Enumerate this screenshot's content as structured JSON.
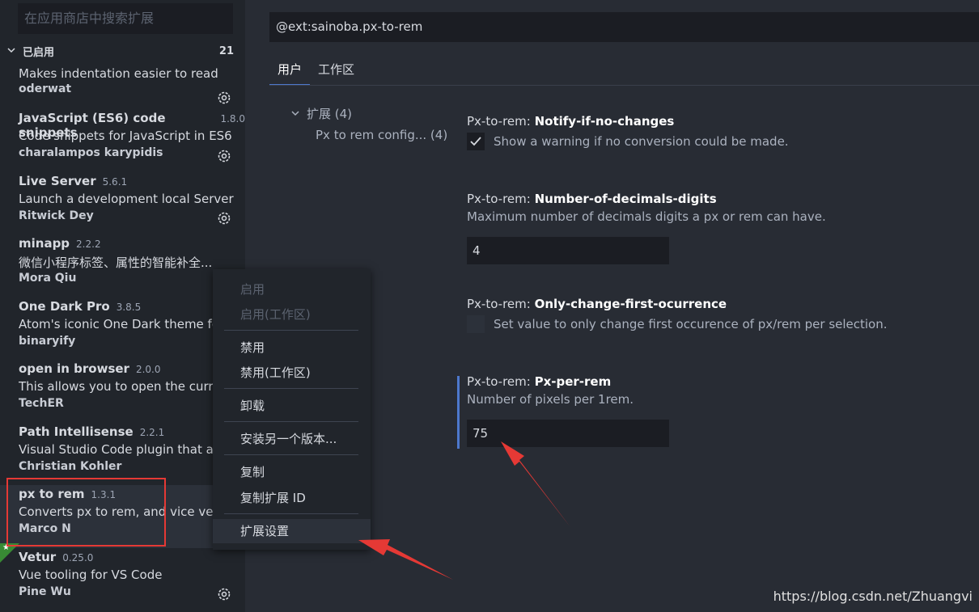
{
  "sidebar": {
    "search_placeholder": "在应用商店中搜索扩展",
    "section_title": "已启用",
    "section_count": "21",
    "extensions": [
      {
        "name": "",
        "version": "",
        "description": "Makes indentation easier to read",
        "author": "oderwat",
        "gear": true
      },
      {
        "name": "JavaScript (ES6) code snippets",
        "version": "1.8.0",
        "description": "Code snippets for JavaScript in ES6 ...",
        "author": "charalampos karypidis",
        "gear": true
      },
      {
        "name": "Live Server",
        "version": "5.6.1",
        "description": "Launch a development local Server ...",
        "author": "Ritwick Dey",
        "gear": true
      },
      {
        "name": "minapp",
        "version": "2.2.2",
        "description": "微信小程序标签、属性的智能补全...",
        "author": "Mora Qiu",
        "gear": false
      },
      {
        "name": "One Dark Pro",
        "version": "3.8.5",
        "description": "Atom's iconic One Dark theme for",
        "author": "binaryify",
        "gear": false
      },
      {
        "name": "open in browser",
        "version": "2.0.0",
        "description": "This allows you to open the curren",
        "author": "TechER",
        "gear": false
      },
      {
        "name": "Path Intellisense",
        "version": "2.2.1",
        "description": "Visual Studio Code plugin that au",
        "author": "Christian Kohler",
        "gear": false
      },
      {
        "name": "px to rem",
        "version": "1.3.1",
        "description": "Converts px to rem, and vice versa",
        "author": "Marco N",
        "gear": false
      },
      {
        "name": "Vetur",
        "version": "0.25.0",
        "description": "Vue tooling for VS Code",
        "author": "Pine Wu",
        "gear": true
      }
    ]
  },
  "context_menu": {
    "items": [
      {
        "label": "启用",
        "disabled": true
      },
      {
        "label": "启用(工作区)",
        "disabled": true
      },
      {
        "label": "禁用",
        "disabled": false
      },
      {
        "label": "禁用(工作区)",
        "disabled": false
      },
      {
        "label": "卸载",
        "disabled": false
      },
      {
        "label": "安装另一个版本...",
        "disabled": false
      },
      {
        "label": "复制",
        "disabled": false
      },
      {
        "label": "复制扩展 ID",
        "disabled": false
      },
      {
        "label": "扩展设置",
        "disabled": false
      }
    ]
  },
  "main": {
    "search_value": "@ext:sainoba.px-to-rem",
    "tabs": [
      {
        "label": "用户",
        "active": true
      },
      {
        "label": "工作区",
        "active": false
      }
    ],
    "toc": {
      "group_label": "扩展 (4)",
      "sub_label": "Px to rem config... (4)"
    },
    "settings": [
      {
        "category": "Px-to-rem: ",
        "key": "Notify-if-no-changes",
        "description": "Show a warning if no conversion could be made.",
        "type": "checkbox",
        "checked": true
      },
      {
        "category": "Px-to-rem: ",
        "key": "Number-of-decimals-digits",
        "description": "Maximum number of decimals digits a px or rem can have.",
        "type": "number",
        "value": "4"
      },
      {
        "category": "Px-to-rem: ",
        "key": "Only-change-first-ocurrence",
        "description": "Set value to only change first occurence of px/rem per selection.",
        "type": "checkbox",
        "checked": false
      },
      {
        "category": "Px-to-rem: ",
        "key": "Px-per-rem",
        "description": "Number of pixels per 1rem.",
        "type": "number",
        "value": "75"
      }
    ]
  },
  "watermark": "https://blog.csdn.net/Zhuangvi",
  "colors": {
    "accent": "#4d78cc",
    "annotation_red": "#e53935",
    "sidebar_bg": "#21252b",
    "editor_bg": "#282c34"
  }
}
